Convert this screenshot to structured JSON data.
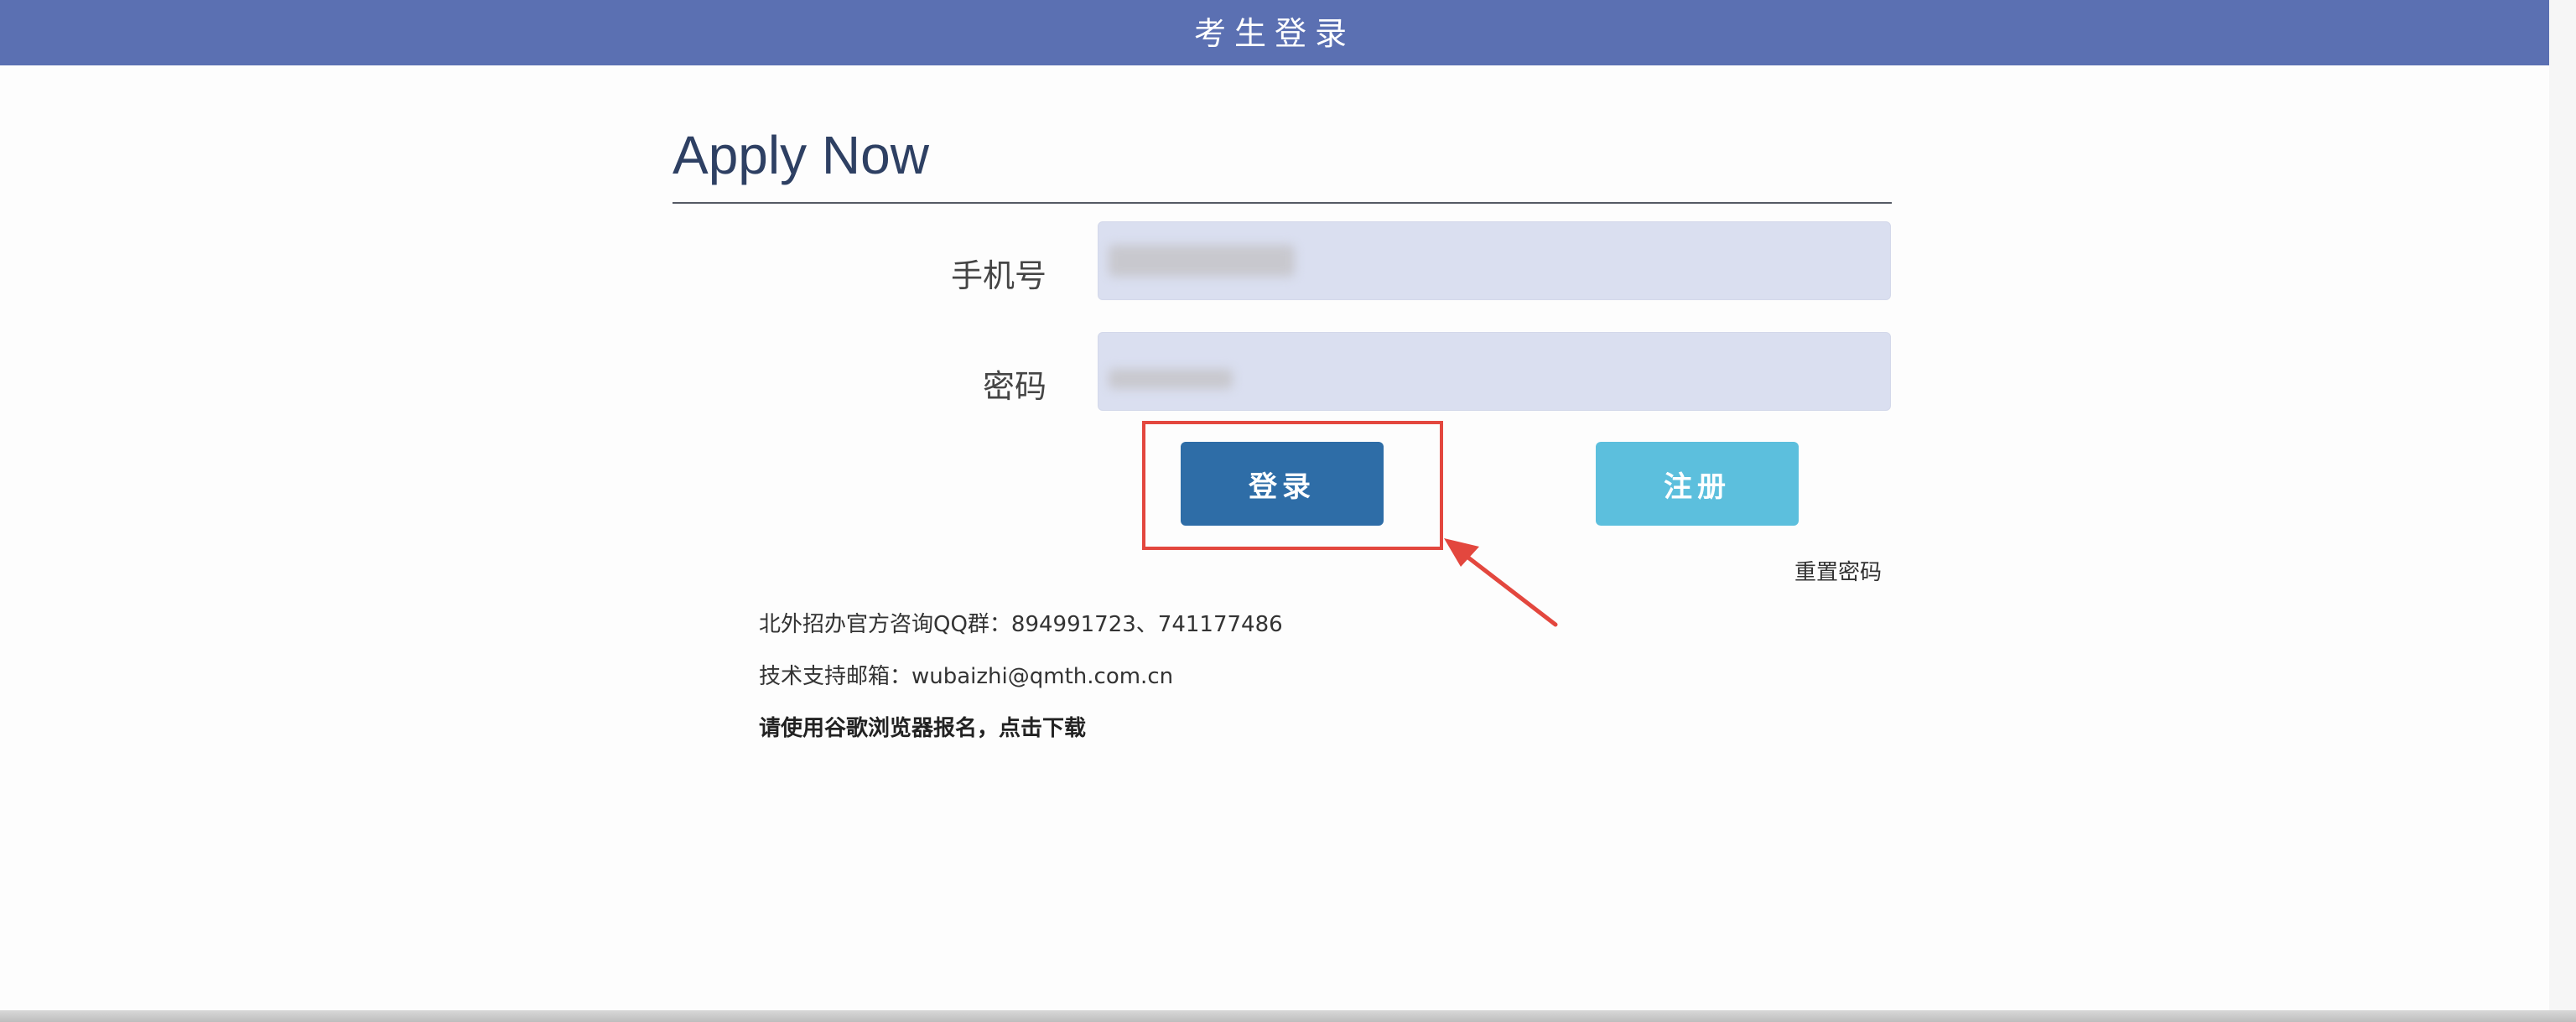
{
  "header": {
    "title": "考生登录"
  },
  "form": {
    "heading": "Apply Now",
    "phone_label": "手机号",
    "phone_value": "",
    "password_label": "密码",
    "password_value": "",
    "login_label": "登录",
    "register_label": "注册",
    "reset_password_label": "重置密码"
  },
  "info": {
    "qq_group": "北外招办官方咨询QQ群：894991723、741177486",
    "support_email": "技术支持邮箱：wubaizhi@qmth.com.cn",
    "browser_notice": "请使用谷歌浏览器报名，点击下载"
  },
  "colors": {
    "header_bg": "#5b70b2",
    "login_button": "#2e6da7",
    "register_button": "#5cbfdd",
    "highlight": "#e3473e"
  }
}
